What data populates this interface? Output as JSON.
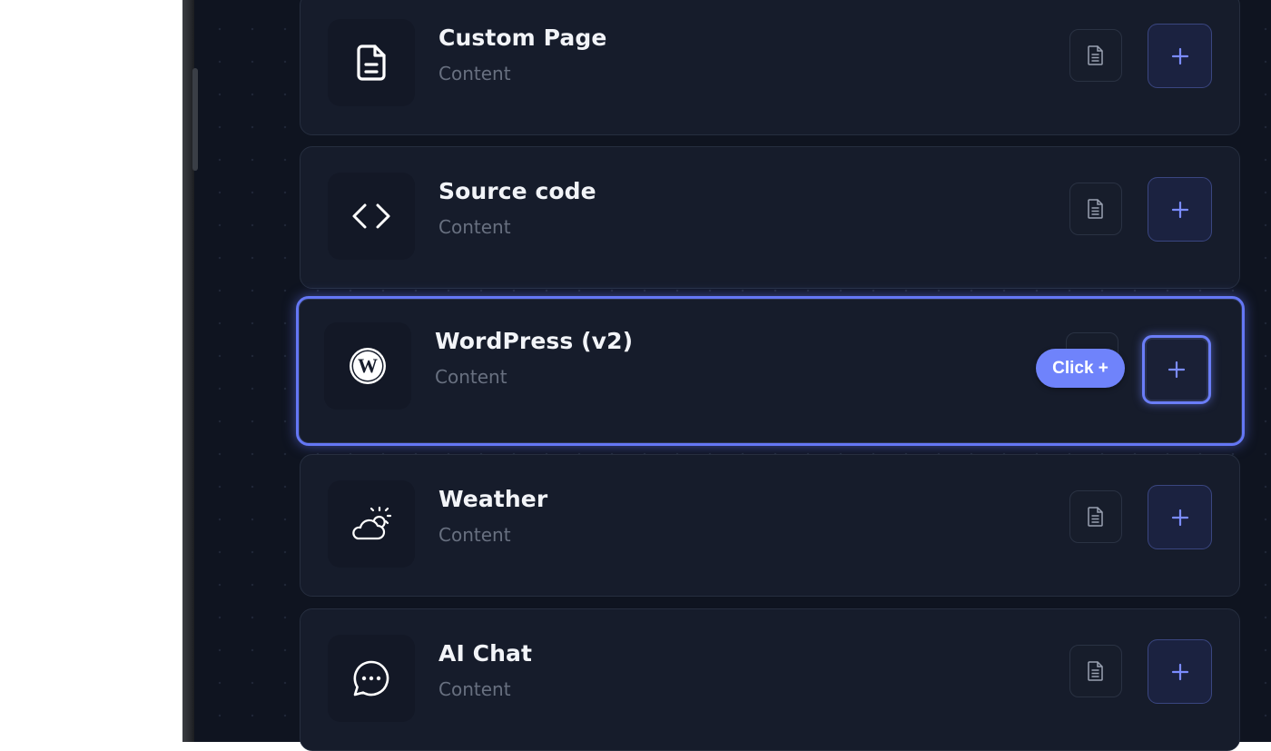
{
  "cards": [
    {
      "title": "Custom Page",
      "subtitle": "Content",
      "icon": "file-text-icon"
    },
    {
      "title": "Source code",
      "subtitle": "Content",
      "icon": "code-icon"
    },
    {
      "title": "WordPress (v2)",
      "subtitle": "Content",
      "icon": "wordpress-icon"
    },
    {
      "title": "Weather",
      "subtitle": "Content",
      "icon": "cloud-sun-icon"
    },
    {
      "title": "AI Chat",
      "subtitle": "Content",
      "icon": "chat-bubble-icon"
    }
  ],
  "add_label": "+",
  "tooltip": {
    "label": "Click +"
  },
  "colors": {
    "panel_bg": "#0f1420",
    "card_bg": "#161c2b",
    "accent": "#6477f5",
    "tooltip_bg": "#6f83fb",
    "title_text": "#f2f4f8",
    "subtitle_text": "#687080"
  }
}
